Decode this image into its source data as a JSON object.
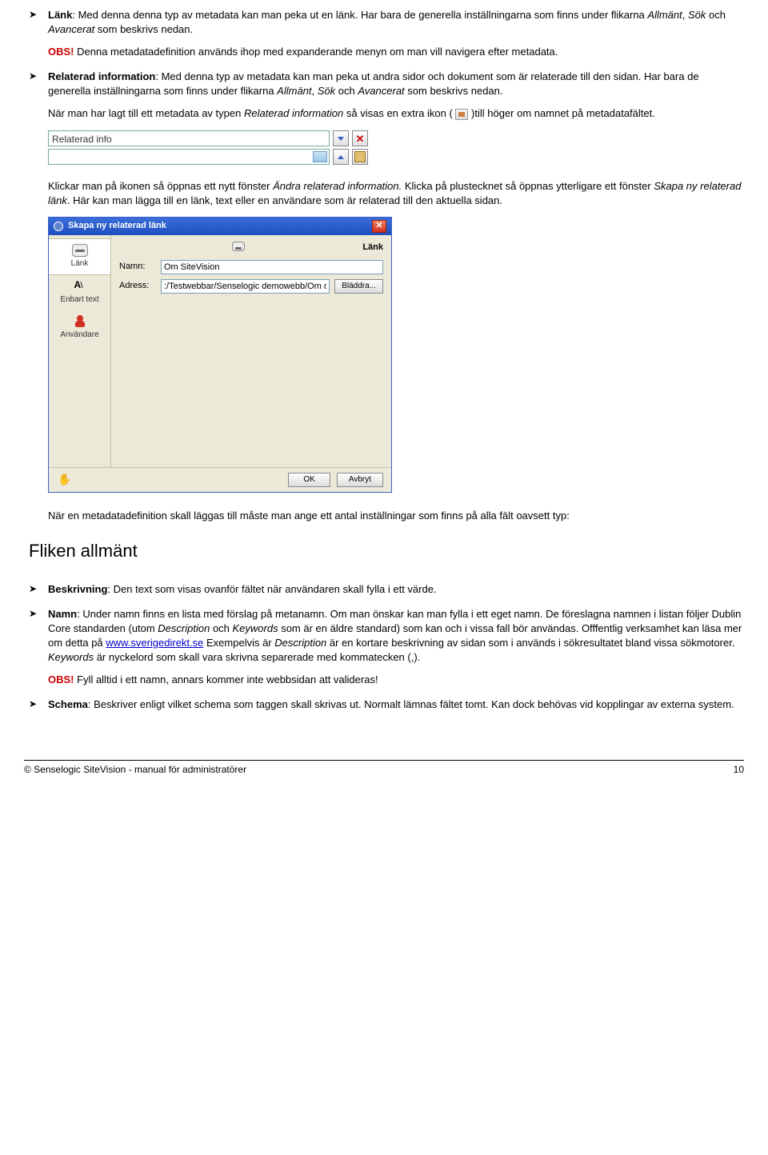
{
  "list1": {
    "item_lank": {
      "label": "Länk",
      "text": ": Med denna denna typ av metadata kan man peka ut en länk. Har bara de generella inställningarna som finns under flikarna ",
      "flik_allmant": "Allmänt",
      "sep1": ", ",
      "flik_sok": "Sök",
      "sep2": " och ",
      "flik_avancerat": "Avancerat",
      "text2": " som beskrivs nedan.",
      "obs": "OBS!",
      "obs_text": " Denna metadatadefinition används ihop med expanderande menyn om man vill navigera efter metadata."
    },
    "item_rel": {
      "label": "Relaterad information",
      "text1": ": Med denna typ av metadata kan man peka ut andra sidor och dokument som är relaterade till den sidan. Har bara de generella inställningarna som finns under flikarna ",
      "flik_allmant": "Allmänt",
      "sep1": ", ",
      "flik_sok": "Sök",
      "sep2": " och ",
      "flik_avancerat": "Avancerat",
      "text2": " som beskrivs nedan.",
      "para2a": "När man har lagt till ett metadata av typen ",
      "para2_rel": "Relaterad information",
      "para2b": " så visas en extra ikon ( ",
      "para2c": " )till höger om namnet på metadatafältet."
    }
  },
  "relinfo_label": "Relaterad info",
  "para_klickar": {
    "a": "Klickar man på ikonen så öppnas ett nytt fönster ",
    "win1": "Ändra relaterad information.",
    "b": " Klicka på plustecknet så öppnas ytterligare ett fönster ",
    "win2": "Skapa ny relaterad länk",
    "c": ". Här kan man lägga till en länk, text eller en användare som är relaterad till den aktuella sidan."
  },
  "dialog": {
    "title": "Skapa ny relaterad länk",
    "side": {
      "lank": "Länk",
      "text": "Enbart text",
      "anvandare": "Användare"
    },
    "section": "Länk",
    "namn_label": "Namn:",
    "namn_value": "Om SiteVision",
    "adress_label": "Adress:",
    "adress_value": ":/Testwebbar/Senselogic demowebb/Om oss",
    "browse": "Bläddra...",
    "ok": "OK",
    "cancel": "Avbryt"
  },
  "para_after_dialog": "När en metadatadefinition skall läggas till måste man ange ett antal inställningar som finns på alla fält oavsett typ:",
  "heading_fliken": "Fliken allmänt",
  "list2": {
    "beskrivning": {
      "label": "Beskrivning",
      "text": ": Den text som visas ovanför fältet när användaren skall fylla i ett värde."
    },
    "namn": {
      "label": "Namn",
      "text1": ": Under namn finns en lista med förslag på metanamn. Om man önskar kan man fylla i ett eget namn. De föreslagna namnen i listan följer Dublin Core standarden (utom ",
      "desc": "Description",
      "text2": " och ",
      "kw": "Keywords",
      "text3": " som är en äldre standard) som kan och i vissa fall bör användas. Offfentlig verksamhet kan läsa mer om detta på ",
      "link": "www.sverigedirekt.se",
      "text4": " Exempelvis är ",
      "desc2": "Description",
      "text5": " är en kortare beskrivning av sidan som i används i sökresultatet bland vissa sökmotorer. ",
      "kw2": "Keywords",
      "text6": " är nyckelord som skall vara skrivna separerade med kommatecken (,).",
      "obs": "OBS!",
      "obs_text": " Fyll alltid i ett namn, annars kommer inte webbsidan att valideras!"
    },
    "schema": {
      "label": "Schema",
      "text": ": Beskriver enligt vilket schema som taggen skall skrivas ut. Normalt lämnas fältet tomt. Kan dock behövas vid kopplingar av externa system."
    }
  },
  "footer": {
    "left": "© Senselogic SiteVision - manual för administratörer",
    "right": "10"
  }
}
